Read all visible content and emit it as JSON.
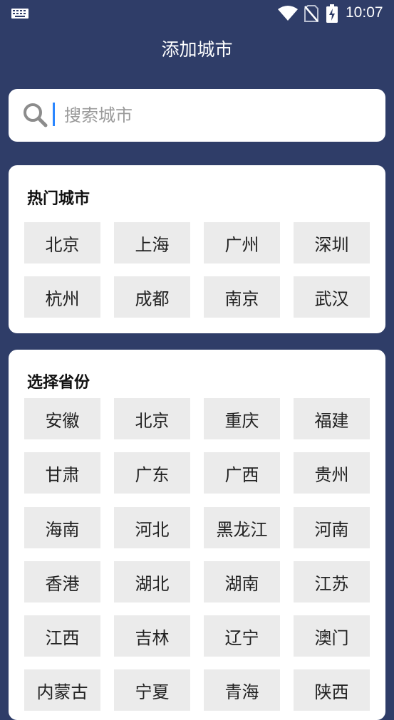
{
  "status_bar": {
    "time": "10:07"
  },
  "header": {
    "title": "添加城市"
  },
  "search": {
    "placeholder": "搜索城市",
    "value": ""
  },
  "hot_cities": {
    "title": "热门城市",
    "items": [
      "北京",
      "上海",
      "广州",
      "深圳",
      "杭州",
      "成都",
      "南京",
      "武汉"
    ]
  },
  "provinces": {
    "title": "选择省份",
    "items": [
      "安徽",
      "北京",
      "重庆",
      "福建",
      "甘肃",
      "广东",
      "广西",
      "贵州",
      "海南",
      "河北",
      "黑龙江",
      "河南",
      "香港",
      "湖北",
      "湖南",
      "江苏",
      "江西",
      "吉林",
      "辽宁",
      "澳门",
      "内蒙古",
      "宁夏",
      "青海",
      "陕西"
    ]
  }
}
